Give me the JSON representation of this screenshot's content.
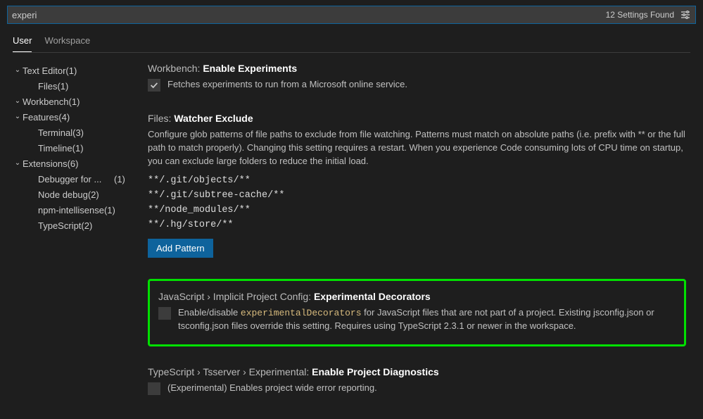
{
  "search": {
    "value": "experi",
    "found_label": "12 Settings Found"
  },
  "tabs": {
    "user": "User",
    "workspace": "Workspace"
  },
  "tree": [
    {
      "label": "Text Editor",
      "count": "(1)",
      "expanded": true,
      "children": [
        {
          "label": "Files",
          "count": "(1)"
        }
      ]
    },
    {
      "label": "Workbench",
      "count": "(1)",
      "expanded": true,
      "children": []
    },
    {
      "label": "Features",
      "count": "(4)",
      "expanded": true,
      "children": [
        {
          "label": "Terminal",
          "count": "(3)"
        },
        {
          "label": "Timeline",
          "count": "(1)"
        }
      ]
    },
    {
      "label": "Extensions",
      "count": "(6)",
      "expanded": true,
      "children": [
        {
          "label": "Debugger for ...",
          "count": "(1)"
        },
        {
          "label": "Node debug",
          "count": "(2)"
        },
        {
          "label": "npm-intellisense",
          "count": "(1)"
        },
        {
          "label": "TypeScript",
          "count": "(2)"
        }
      ]
    }
  ],
  "settings": {
    "experiments": {
      "scope": "Workbench:",
      "name": "Enable Experiments",
      "desc": "Fetches experiments to run from a Microsoft online service.",
      "checked": true
    },
    "watcher": {
      "scope": "Files:",
      "name": "Watcher Exclude",
      "desc": "Configure glob patterns of file paths to exclude from file watching. Patterns must match on absolute paths (i.e. prefix with ** or the full path to match properly). Changing this setting requires a restart. When you experience Code consuming lots of CPU time on startup, you can exclude large folders to reduce the initial load.",
      "patterns": [
        "**/.git/objects/**",
        "**/.git/subtree-cache/**",
        "**/node_modules/**",
        "**/.hg/store/**"
      ],
      "add_label": "Add Pattern"
    },
    "decorators": {
      "scope": "JavaScript › Implicit Project Config:",
      "name": "Experimental Decorators",
      "desc_pre": "Enable/disable ",
      "code": "experimentalDecorators",
      "desc_post": " for JavaScript files that are not part of a project. Existing jsconfig.json or tsconfig.json files override this setting. Requires using TypeScript 2.3.1 or newer in the workspace.",
      "checked": false
    },
    "tsdiag": {
      "scope": "TypeScript › Tsserver › Experimental:",
      "name": "Enable Project Diagnostics",
      "desc": "(Experimental) Enables project wide error reporting.",
      "checked": false
    }
  }
}
